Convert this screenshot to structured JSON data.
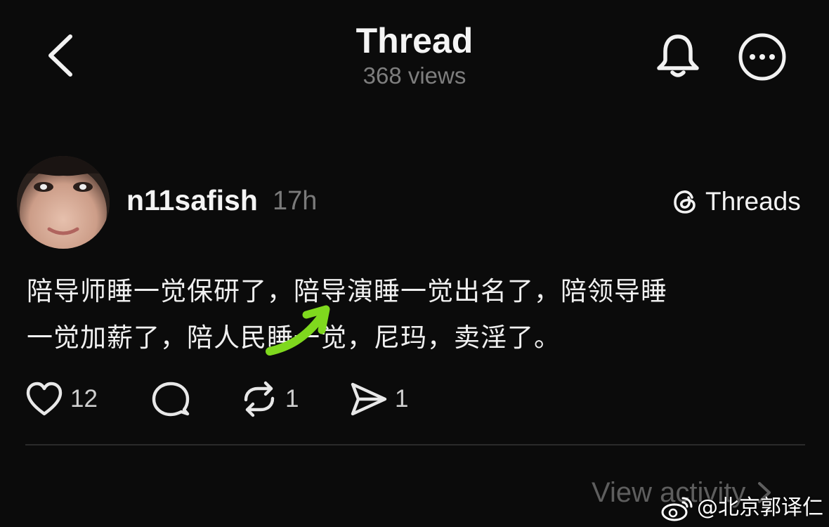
{
  "header": {
    "title": "Thread",
    "subtitle": "368 views",
    "back_icon": "chevron-left-icon",
    "bell_icon": "bell-icon",
    "more_icon": "more-horizontal-icon"
  },
  "post": {
    "username": "n11safish",
    "time": "17h",
    "badge_label": "Threads",
    "text_line1": "陪导师睡一觉保研了，陪导演睡一觉出名了，陪领导睡",
    "text_line2": "一觉加薪了，陪人民睡一觉，尼玛，卖淫了。",
    "actions": {
      "like_count": "12",
      "repost_count": "1",
      "share_count": "1"
    }
  },
  "footer": {
    "view_activity_label": "View activity"
  },
  "watermark": {
    "text": "@北京郭译仁"
  },
  "colors": {
    "background": "#0b0b0b",
    "annotation": "#7fd81e",
    "muted": "#7e7e7e"
  }
}
